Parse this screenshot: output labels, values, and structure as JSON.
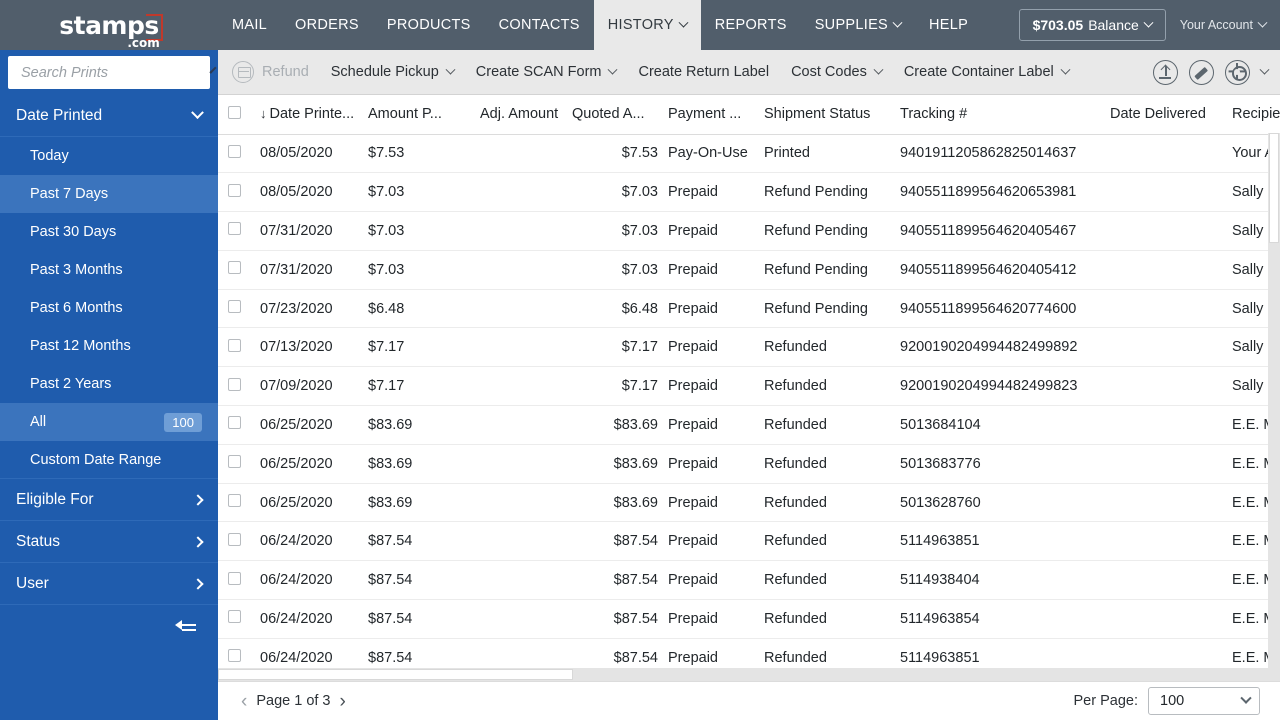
{
  "topnav": {
    "logo": {
      "main": "stamps",
      "suffix": ".com"
    },
    "menu": [
      {
        "label": "MAIL",
        "has_caret": false,
        "active": false
      },
      {
        "label": "ORDERS",
        "has_caret": false,
        "active": false
      },
      {
        "label": "PRODUCTS",
        "has_caret": false,
        "active": false
      },
      {
        "label": "CONTACTS",
        "has_caret": false,
        "active": false
      },
      {
        "label": "HISTORY",
        "has_caret": true,
        "active": true
      },
      {
        "label": "REPORTS",
        "has_caret": false,
        "active": false
      },
      {
        "label": "SUPPLIES",
        "has_caret": true,
        "active": false
      },
      {
        "label": "HELP",
        "has_caret": false,
        "active": false
      }
    ],
    "balance_amount": "$703.05",
    "balance_label": "Balance",
    "account_label": "Your Account"
  },
  "sidebar": {
    "search": {
      "placeholder": "Search Prints",
      "value": ""
    },
    "groups": [
      {
        "label": "Date Printed",
        "expanded": true,
        "items": [
          {
            "label": "Today",
            "badge": "",
            "selected": false
          },
          {
            "label": "Past 7 Days",
            "badge": "",
            "selected": true
          },
          {
            "label": "Past 30 Days",
            "badge": "",
            "selected": false
          },
          {
            "label": "Past 3 Months",
            "badge": "",
            "selected": false
          },
          {
            "label": "Past 6 Months",
            "badge": "",
            "selected": false
          },
          {
            "label": "Past 12 Months",
            "badge": "",
            "selected": false
          },
          {
            "label": "Past 2 Years",
            "badge": "",
            "selected": false
          },
          {
            "label": "All",
            "badge": "100",
            "selected": true
          },
          {
            "label": "Custom Date Range",
            "badge": "",
            "selected": false
          }
        ]
      },
      {
        "label": "Eligible For",
        "expanded": false,
        "items": []
      },
      {
        "label": "Status",
        "expanded": false,
        "items": []
      },
      {
        "label": "User",
        "expanded": false,
        "items": []
      }
    ]
  },
  "toolbar": {
    "items": [
      {
        "label": "Refund",
        "caret": false,
        "disabled": true,
        "icon": "refund-icon"
      },
      {
        "label": "Schedule Pickup",
        "caret": true,
        "disabled": false
      },
      {
        "label": "Create SCAN Form",
        "caret": true,
        "disabled": false
      },
      {
        "label": "Create Return Label",
        "caret": false,
        "disabled": false
      },
      {
        "label": "Cost Codes",
        "caret": true,
        "disabled": false
      },
      {
        "label": "Create Container Label",
        "caret": true,
        "disabled": false
      }
    ]
  },
  "table": {
    "columns": [
      {
        "key": "check",
        "label": ""
      },
      {
        "key": "date_printed",
        "label": "Date Printe...",
        "sorted": true,
        "sort_dir": "↓"
      },
      {
        "key": "amount_paid",
        "label": "Amount P..."
      },
      {
        "key": "adj_amount",
        "label": "Adj. Amount"
      },
      {
        "key": "quoted_amount",
        "label": "Quoted A..."
      },
      {
        "key": "payment",
        "label": "Payment ..."
      },
      {
        "key": "shipment_status",
        "label": "Shipment Status"
      },
      {
        "key": "tracking",
        "label": "Tracking #"
      },
      {
        "key": "date_delivered",
        "label": "Date Delivered"
      },
      {
        "key": "recipient",
        "label": "Recipient"
      }
    ],
    "rows": [
      {
        "check": false,
        "date_printed": "08/05/2020",
        "amount_paid": "$7.53",
        "adj_amount": "",
        "quoted_amount": "$7.53",
        "payment": "Pay-On-Use",
        "shipment_status": "Printed",
        "tracking": "9401911205862825014637",
        "date_delivered": "",
        "recipient": "Your Ac"
      },
      {
        "check": false,
        "date_printed": "08/05/2020",
        "amount_paid": "$7.03",
        "adj_amount": "",
        "quoted_amount": "$7.03",
        "payment": "Prepaid",
        "shipment_status": "Refund Pending",
        "tracking": "9405511899564620653981",
        "date_delivered": "",
        "recipient": "Sally Pu"
      },
      {
        "check": false,
        "date_printed": "07/31/2020",
        "amount_paid": "$7.03",
        "adj_amount": "",
        "quoted_amount": "$7.03",
        "payment": "Prepaid",
        "shipment_status": "Refund Pending",
        "tracking": "9405511899564620405467",
        "date_delivered": "",
        "recipient": "Sally Pu"
      },
      {
        "check": false,
        "date_printed": "07/31/2020",
        "amount_paid": "$7.03",
        "adj_amount": "",
        "quoted_amount": "$7.03",
        "payment": "Prepaid",
        "shipment_status": "Refund Pending",
        "tracking": "9405511899564620405412",
        "date_delivered": "",
        "recipient": "Sally Pu"
      },
      {
        "check": false,
        "date_printed": "07/23/2020",
        "amount_paid": "$6.48",
        "adj_amount": "",
        "quoted_amount": "$6.48",
        "payment": "Prepaid",
        "shipment_status": "Refund Pending",
        "tracking": "9405511899564620774600",
        "date_delivered": "",
        "recipient": "Sally Pu"
      },
      {
        "check": false,
        "date_printed": "07/13/2020",
        "amount_paid": "$7.17",
        "adj_amount": "",
        "quoted_amount": "$7.17",
        "payment": "Prepaid",
        "shipment_status": "Refunded",
        "tracking": "9200190204994482499892",
        "date_delivered": "",
        "recipient": "Sally Pu"
      },
      {
        "check": false,
        "date_printed": "07/09/2020",
        "amount_paid": "$7.17",
        "adj_amount": "",
        "quoted_amount": "$7.17",
        "payment": "Prepaid",
        "shipment_status": "Refunded",
        "tracking": "9200190204994482499823",
        "date_delivered": "",
        "recipient": "Sally Pu"
      },
      {
        "check": false,
        "date_printed": "06/25/2020",
        "amount_paid": "$83.69",
        "adj_amount": "",
        "quoted_amount": "$83.69",
        "payment": "Prepaid",
        "shipment_status": "Refunded",
        "tracking": "5013684104",
        "date_delivered": "",
        "recipient": "E.E. Mis"
      },
      {
        "check": false,
        "date_printed": "06/25/2020",
        "amount_paid": "$83.69",
        "adj_amount": "",
        "quoted_amount": "$83.69",
        "payment": "Prepaid",
        "shipment_status": "Refunded",
        "tracking": "5013683776",
        "date_delivered": "",
        "recipient": "E.E. Mis"
      },
      {
        "check": false,
        "date_printed": "06/25/2020",
        "amount_paid": "$83.69",
        "adj_amount": "",
        "quoted_amount": "$83.69",
        "payment": "Prepaid",
        "shipment_status": "Refunded",
        "tracking": "5013628760",
        "date_delivered": "",
        "recipient": "E.E. Mis"
      },
      {
        "check": false,
        "date_printed": "06/24/2020",
        "amount_paid": "$87.54",
        "adj_amount": "",
        "quoted_amount": "$87.54",
        "payment": "Prepaid",
        "shipment_status": "Refunded",
        "tracking": "5114963851",
        "date_delivered": "",
        "recipient": "E.E. Mis"
      },
      {
        "check": false,
        "date_printed": "06/24/2020",
        "amount_paid": "$87.54",
        "adj_amount": "",
        "quoted_amount": "$87.54",
        "payment": "Prepaid",
        "shipment_status": "Refunded",
        "tracking": "5114938404",
        "date_delivered": "",
        "recipient": "E.E. Mis"
      },
      {
        "check": false,
        "date_printed": "06/24/2020",
        "amount_paid": "$87.54",
        "adj_amount": "",
        "quoted_amount": "$87.54",
        "payment": "Prepaid",
        "shipment_status": "Refunded",
        "tracking": "5114963854",
        "date_delivered": "",
        "recipient": "E.E. Mis"
      },
      {
        "check": false,
        "date_printed": "06/24/2020",
        "amount_paid": "$87.54",
        "adj_amount": "",
        "quoted_amount": "$87.54",
        "payment": "Prepaid",
        "shipment_status": "Refunded",
        "tracking": "5114963851",
        "date_delivered": "",
        "recipient": "E.E. Mis"
      }
    ]
  },
  "footer": {
    "prev_arrow": "‹",
    "next_arrow": "›",
    "page_text": "Page  1 of 3",
    "per_page_label": "Per Page:",
    "per_page_value": "100"
  },
  "colors": {
    "topnav_bg": "#515e6b",
    "sidebar_bg": "#1f5cad",
    "sidebar_selected": "#3b74bd",
    "toolbar_bg": "#e9e9e9",
    "accent_red": "#c0392b",
    "active_tab_bg": "#e9e9e9"
  }
}
